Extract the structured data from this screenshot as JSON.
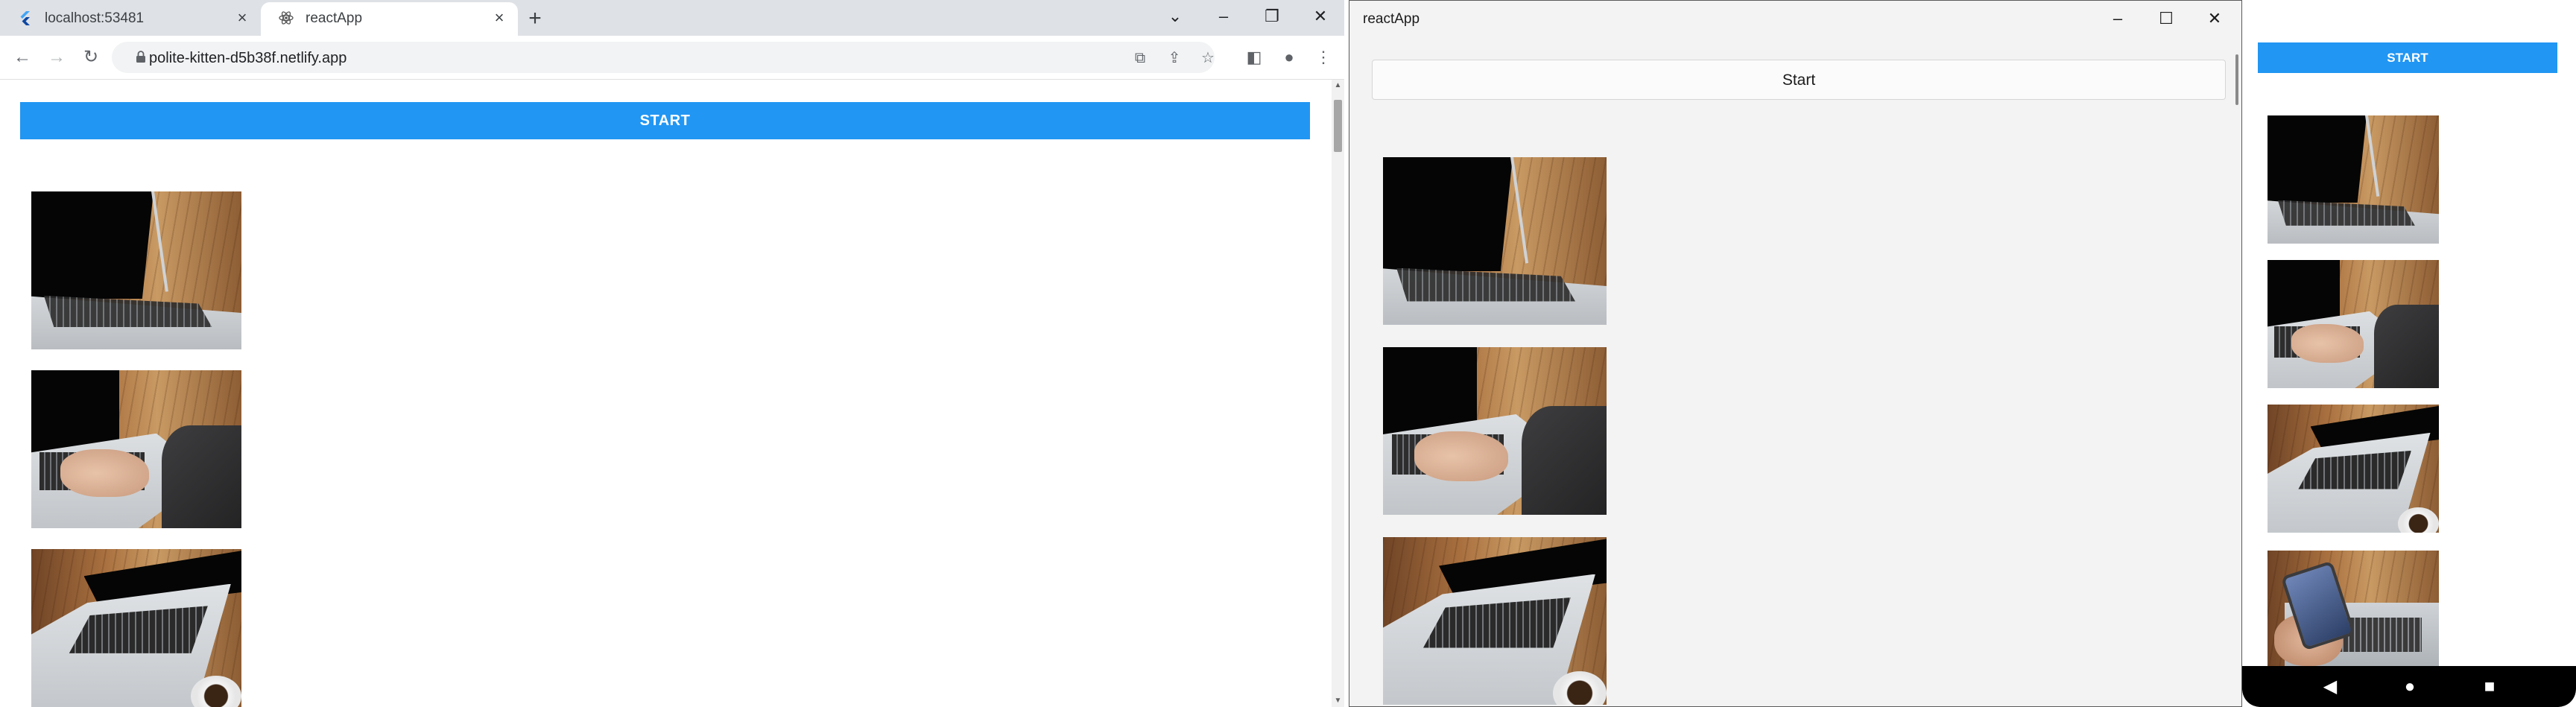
{
  "browser": {
    "tabs": [
      {
        "title": "localhost:53481",
        "active": false
      },
      {
        "title": "reactApp",
        "active": true
      }
    ],
    "new_tab_symbol": "+",
    "url": "polite-kitten-d5b38f.netlify.app",
    "page": {
      "start_label": "START",
      "images": [
        "laptop-photo-1",
        "laptop-photo-2",
        "laptop-photo-3"
      ]
    }
  },
  "desktop": {
    "title": "reactApp",
    "start_label": "Start",
    "images": [
      "laptop-photo-1",
      "laptop-photo-2",
      "laptop-photo-3"
    ]
  },
  "android": {
    "start_label": "START",
    "images": [
      "laptop-photo-1",
      "laptop-photo-2",
      "laptop-photo-3",
      "phone-photo-4"
    ]
  },
  "colors": {
    "accent": "#2196f3",
    "tabstrip": "#dee1e6",
    "desktop_bg": "#f3f3f3"
  }
}
